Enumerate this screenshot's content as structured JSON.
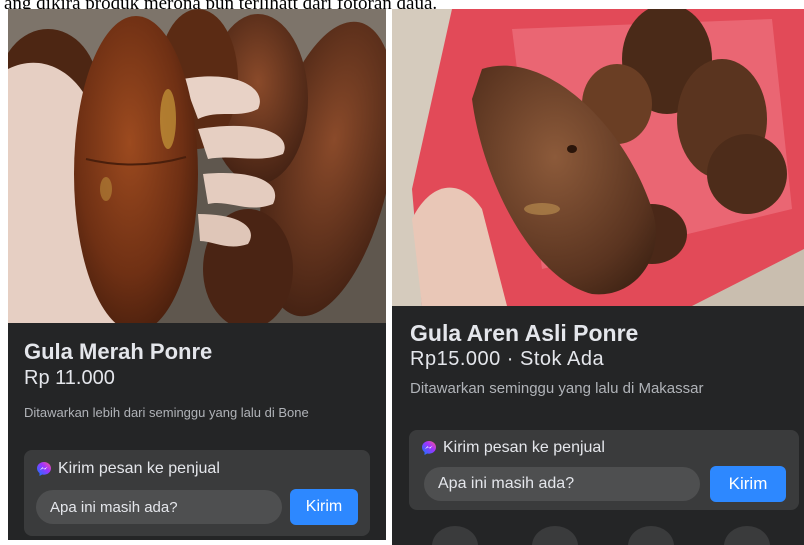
{
  "caption": {
    "text": "ang dikira produk merona pun terlihatt dari fotoran daua."
  },
  "left_listing": {
    "title": "Gula Merah Ponre",
    "price": "Rp 11.000",
    "meta": "Ditawarkan lebih dari seminggu yang lalu di Bone",
    "message_heading": "Kirim pesan ke penjual",
    "message_input_value": "Apa ini masih ada?",
    "send_label": "Kirim"
  },
  "right_listing": {
    "title": "Gula Aren Asli Ponre",
    "price": "Rp15.000 · Stok Ada",
    "meta": "Ditawarkan seminggu yang lalu di Makassar",
    "message_heading": "Kirim pesan ke penjual",
    "message_input_value": "Apa ini masih ada?",
    "send_label": "Kirim"
  },
  "icons": {
    "messenger": "messenger-icon",
    "bottom_actions": [
      "share-icon",
      "save-icon",
      "note-icon",
      "play-icon"
    ]
  },
  "colors": {
    "panel_bg": "#242526",
    "card_bg": "#3a3b3c",
    "input_bg": "#4e4f50",
    "accent": "#2d88ff",
    "text_primary": "#e4e6eb",
    "text_secondary": "#b0b3b8"
  }
}
